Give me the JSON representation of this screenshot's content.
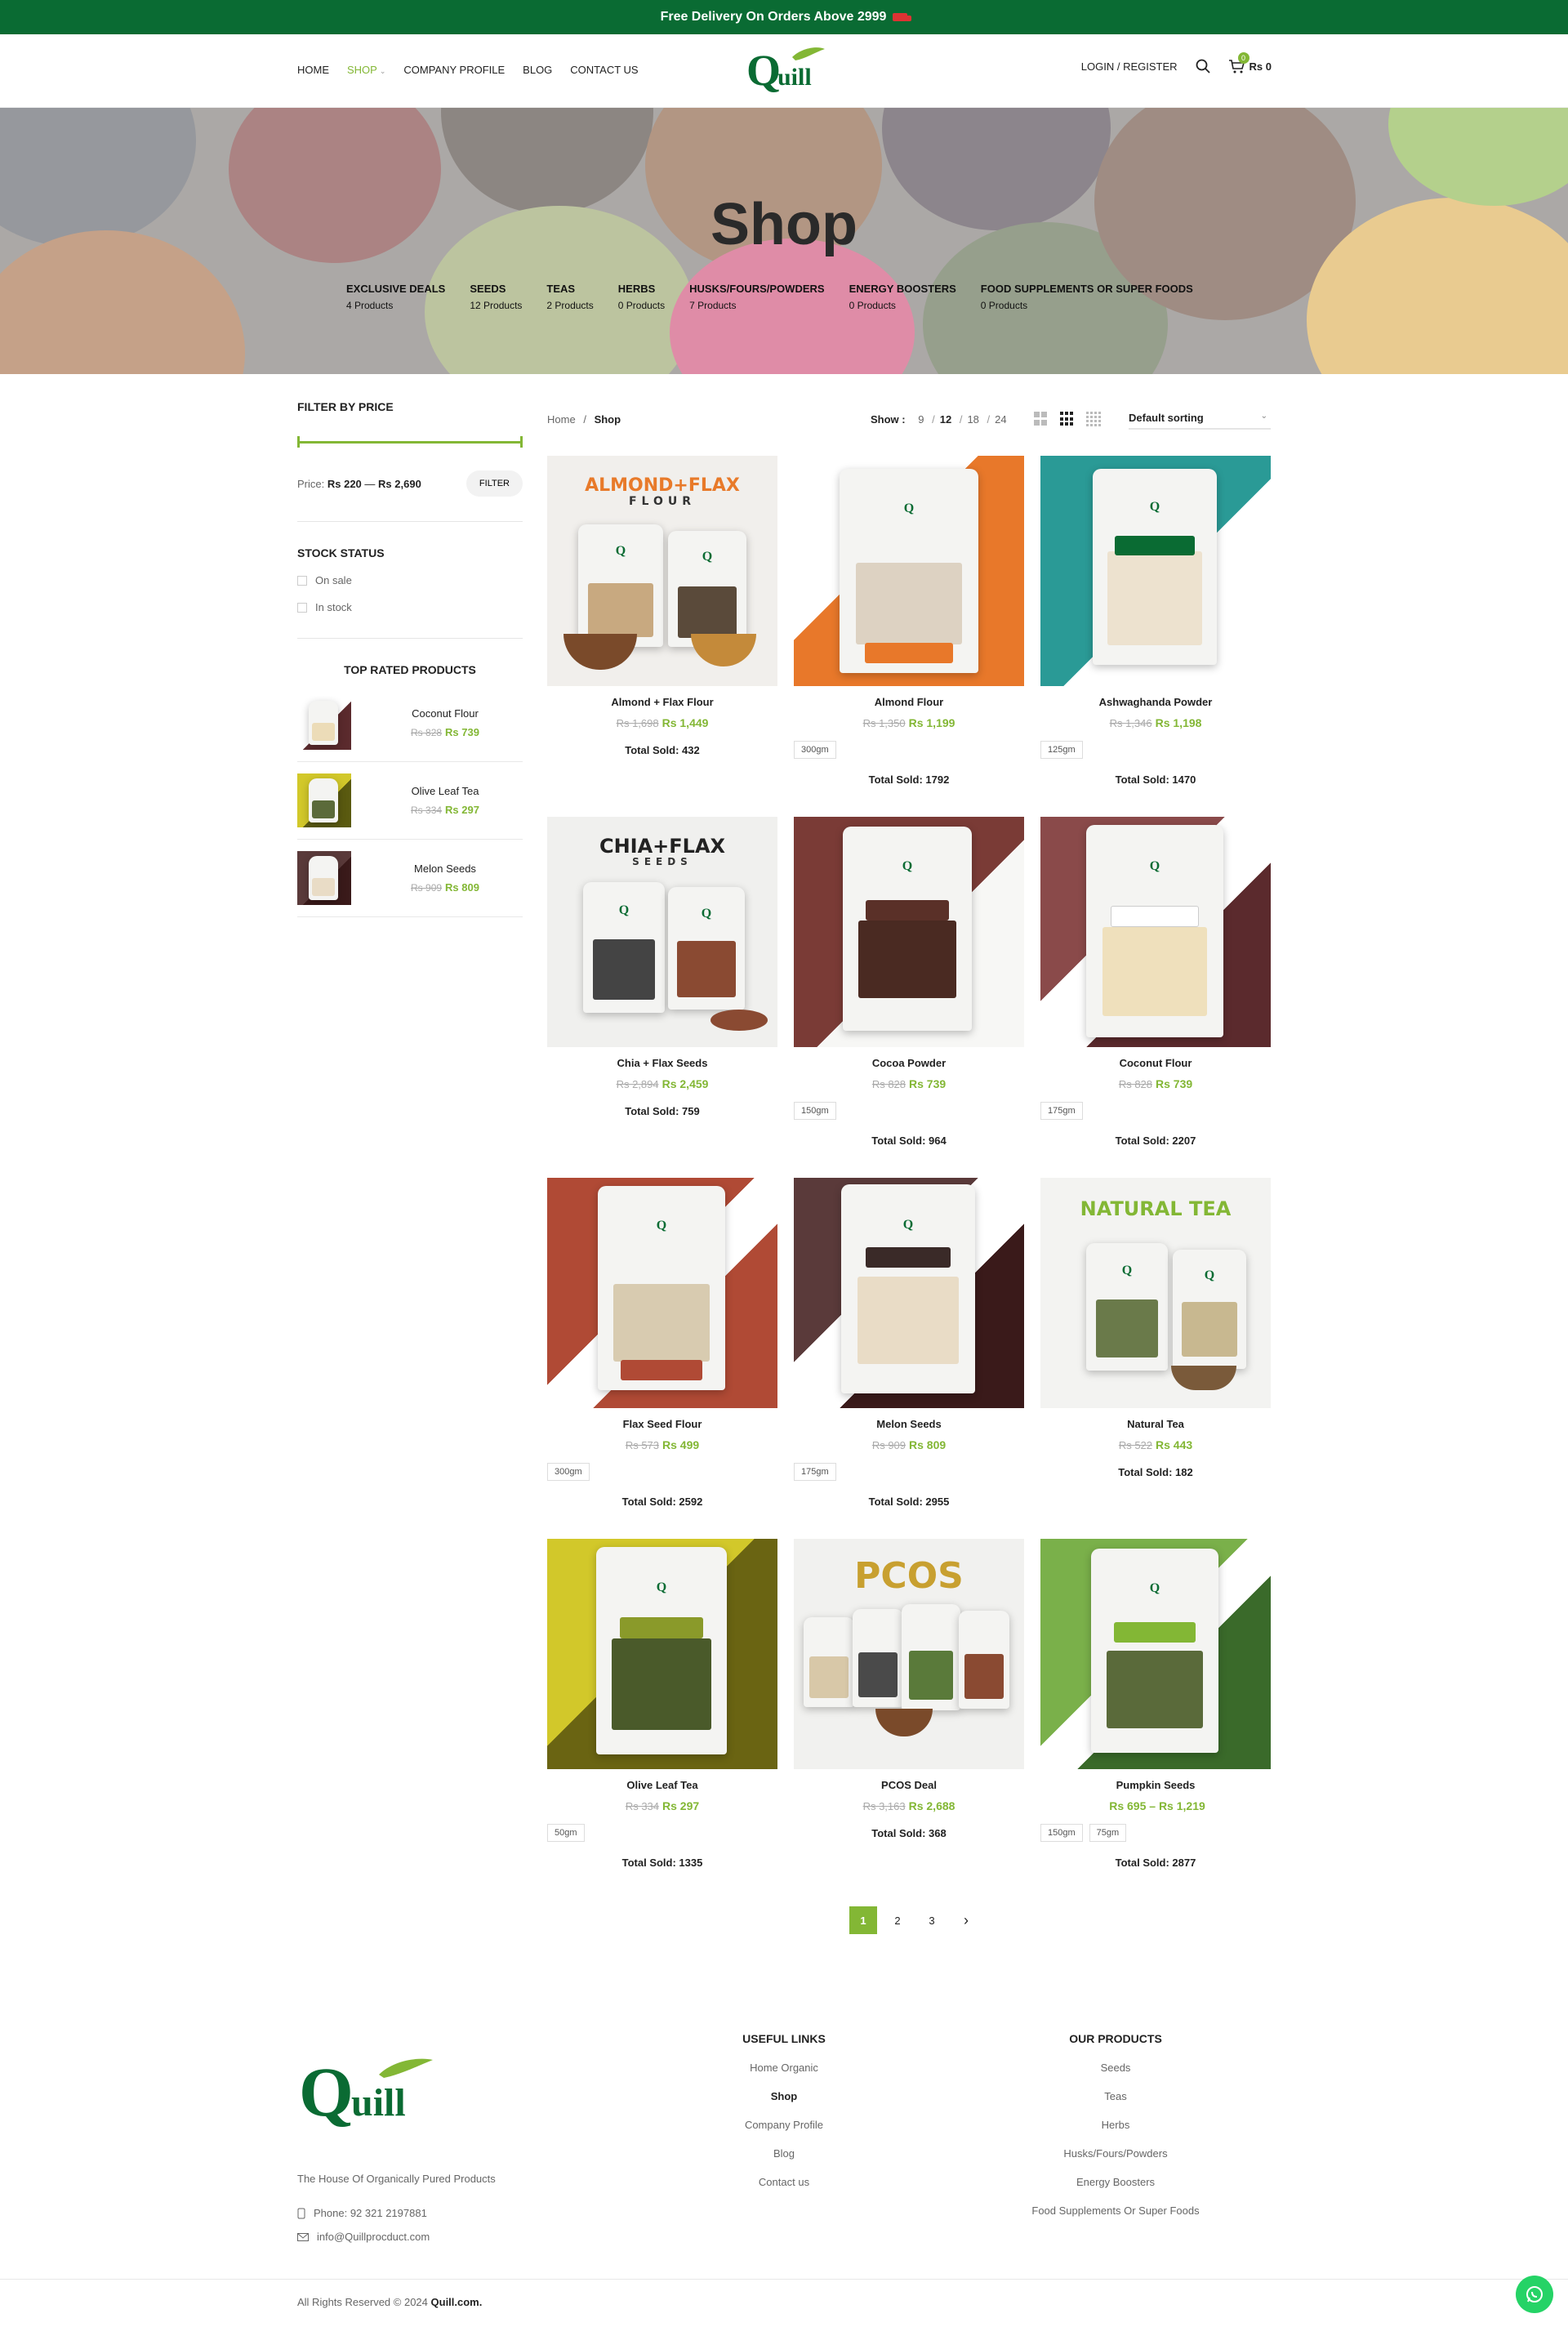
{
  "topbar": {
    "text": "Free Delivery On Orders Above 2999"
  },
  "nav": {
    "home": "HOME",
    "shop": "SHOP",
    "company": "COMPANY PROFILE",
    "blog": "BLOG",
    "contact": "CONTACT US",
    "login": "LOGIN / REGISTER",
    "cart_count": "0",
    "cart_total": "Rs 0"
  },
  "logo_text": "Quill",
  "hero": {
    "title": "Shop",
    "categories": [
      {
        "name": "EXCLUSIVE DEALS",
        "count": "4 Products"
      },
      {
        "name": "SEEDS",
        "count": "12 Products"
      },
      {
        "name": "TEAS",
        "count": "2 Products"
      },
      {
        "name": "HERBS",
        "count": "0 Products"
      },
      {
        "name": "HUSKS/FOURS/POWDERS",
        "count": "7 Products"
      },
      {
        "name": "ENERGY BOOSTERS",
        "count": "0 Products"
      },
      {
        "name": "FOOD SUPPLEMENTS OR SUPER FOODS",
        "count": "0 Products"
      }
    ]
  },
  "sidebar": {
    "filter_title": "FILTER BY PRICE",
    "price_label": "Price:",
    "price_min": "Rs 220",
    "price_dash": "—",
    "price_max": "Rs 2,690",
    "filter_button": "FILTER",
    "stock_title": "STOCK STATUS",
    "stock_on_sale": "On sale",
    "stock_in_stock": "In stock",
    "top_rated_title": "TOP RATED PRODUCTS",
    "top_rated": [
      {
        "name": "Coconut Flour",
        "old": "Rs 828",
        "new": "Rs 739"
      },
      {
        "name": "Olive Leaf Tea",
        "old": "Rs 334",
        "new": "Rs 297"
      },
      {
        "name": "Melon Seeds",
        "old": "Rs 909",
        "new": "Rs 809"
      }
    ]
  },
  "toolbar": {
    "breadcrumb_home": "Home",
    "breadcrumb_sep": "/",
    "breadcrumb_current": "Shop",
    "show_label": "Show :",
    "show_options": [
      "9",
      "12",
      "18",
      "24"
    ],
    "show_selected": "12",
    "sorting": "Default sorting"
  },
  "products": [
    {
      "name": "Almond + Flax Flour",
      "old": "Rs 1,698",
      "new": "Rs 1,449",
      "swatches": [],
      "sold": "Total Sold: 432"
    },
    {
      "name": "Almond Flour",
      "old": "Rs 1,350",
      "new": "Rs 1,199",
      "swatches": [
        "300gm"
      ],
      "sold": "Total Sold: 1792"
    },
    {
      "name": "Ashwaghanda Powder",
      "old": "Rs 1,346",
      "new": "Rs 1,198",
      "swatches": [
        "125gm"
      ],
      "sold": "Total Sold: 1470"
    },
    {
      "name": "Chia + Flax Seeds",
      "old": "Rs 2,894",
      "new": "Rs 2,459",
      "swatches": [],
      "sold": "Total Sold: 759"
    },
    {
      "name": "Cocoa Powder",
      "old": "Rs 828",
      "new": "Rs 739",
      "swatches": [
        "150gm"
      ],
      "sold": "Total Sold: 964"
    },
    {
      "name": "Coconut Flour",
      "old": "Rs 828",
      "new": "Rs 739",
      "swatches": [
        "175gm"
      ],
      "sold": "Total Sold: 2207"
    },
    {
      "name": "Flax Seed Flour",
      "old": "Rs 573",
      "new": "Rs 499",
      "swatches": [
        "300gm"
      ],
      "sold": "Total Sold: 2592"
    },
    {
      "name": "Melon Seeds",
      "old": "Rs 909",
      "new": "Rs 809",
      "swatches": [
        "175gm"
      ],
      "sold": "Total Sold: 2955"
    },
    {
      "name": "Natural Tea",
      "old": "Rs 522",
      "new": "Rs 443",
      "swatches": [],
      "sold": "Total Sold: 182"
    },
    {
      "name": "Olive Leaf Tea",
      "old": "Rs 334",
      "new": "Rs 297",
      "swatches": [
        "50gm"
      ],
      "sold": "Total Sold: 1335"
    },
    {
      "name": "PCOS Deal",
      "old": "Rs 3,163",
      "new": "Rs 2,688",
      "swatches": [],
      "sold": "Total Sold: 368"
    },
    {
      "name": "Pumpkin Seeds",
      "old": "",
      "new": "Rs 695 – Rs 1,219",
      "swatches": [
        "150gm",
        "75gm"
      ],
      "sold": "Total Sold: 2877"
    }
  ],
  "product_art": [
    {
      "title": "ALMOND+FLAX",
      "sub": "FLOUR",
      "bg": "#f1efec"
    },
    {
      "title": "",
      "sub": "",
      "bg": "#e8782a"
    },
    {
      "title": "",
      "sub": "",
      "bg": "#2a9a96"
    },
    {
      "title": "CHIA+FLAX",
      "sub": "SEEDS",
      "bg": "#f0f0ee"
    },
    {
      "title": "",
      "sub": "",
      "bg": "#7a3b36"
    },
    {
      "title": "",
      "sub": "",
      "bg": "#5b2a2d"
    },
    {
      "title": "",
      "sub": "",
      "bg": "#b04a35"
    },
    {
      "title": "",
      "sub": "",
      "bg": "#4a2a2a"
    },
    {
      "title": "NATURAL TEA",
      "sub": "",
      "bg": "#f3f3f1"
    },
    {
      "title": "",
      "sub": "",
      "bg": "#b8b01a"
    },
    {
      "title": "PCOS",
      "sub": "",
      "bg": "#f1f1ef"
    },
    {
      "title": "",
      "sub": "",
      "bg": "#5a8f3a"
    }
  ],
  "pagination": {
    "pages": [
      "1",
      "2",
      "3"
    ],
    "current": "1",
    "next": "›"
  },
  "footer": {
    "tagline": "The House Of Organically Pured Products",
    "phone": "Phone: 92 321 2197881",
    "email": "info@Quillprocduct.com",
    "useful_title": "USEFUL LINKS",
    "useful": [
      "Home Organic",
      "Shop",
      "Company Profile",
      "Blog",
      "Contact us"
    ],
    "products_title": "OUR PRODUCTS",
    "products": [
      "Seeds",
      "Teas",
      "Herbs",
      "Husks/Fours/Powders",
      "Energy Boosters",
      "Food Supplements Or Super Foods"
    ],
    "copyright": "All Rights Reserved © 2024",
    "copyright_site": "Quill.com."
  },
  "colors": {
    "brand_green": "#0a6b33",
    "accent": "#83b735"
  }
}
